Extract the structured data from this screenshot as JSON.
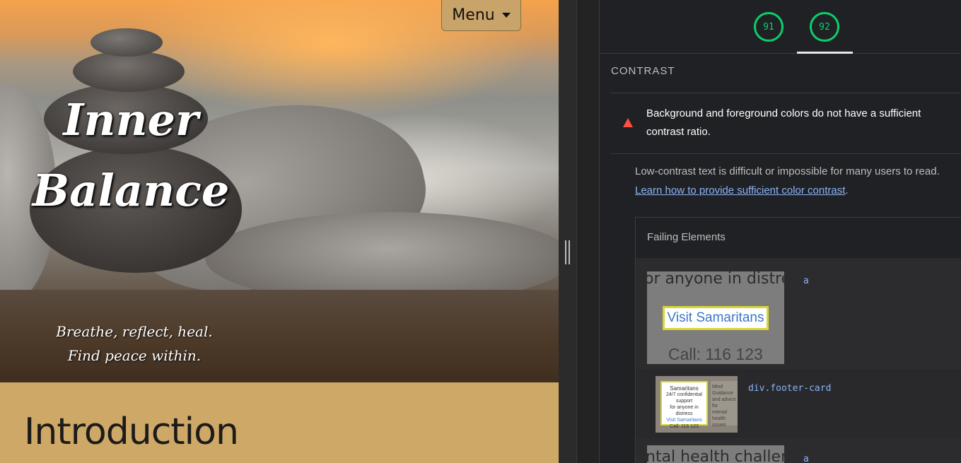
{
  "site": {
    "menu_label": "Menu",
    "hero_title_line1": "Inner",
    "hero_title_line2": "Balance",
    "tagline_line1": "Breathe, reflect, heal.",
    "tagline_line2": "Find peace within.",
    "intro_heading": "Introduction"
  },
  "panel": {
    "scores": [
      {
        "value": "91",
        "color": "#0cce6b"
      },
      {
        "value": "92",
        "color": "#0cce6b"
      }
    ],
    "section_title": "CONTRAST",
    "audit_title": "Background and foreground colors do not have a sufficient contrast ratio.",
    "description": "Low-contrast text is difficult or impossible for many users to read.",
    "learn_link": "Learn how to provide sufficient color contrast",
    "failing_header": "Failing Elements",
    "items": [
      {
        "selector": "a",
        "thumb_top": "or anyone in distres",
        "thumb_button": "Visit Samaritans",
        "thumb_call": "Call: 116 123"
      },
      {
        "selector": "div.footer-card",
        "card_title": "Samaritans",
        "card_line1": "24/7 confidential support",
        "card_line2": "for anyone in distress",
        "card_link": "Visit Samaritans",
        "card_call": "Call: 116 123",
        "card2_title": "Mind",
        "card2_line1": "Guidance and advice for",
        "card2_line2": "mental health issues"
      },
      {
        "selector": "a",
        "thumb_top": "ntal health challen"
      }
    ]
  }
}
